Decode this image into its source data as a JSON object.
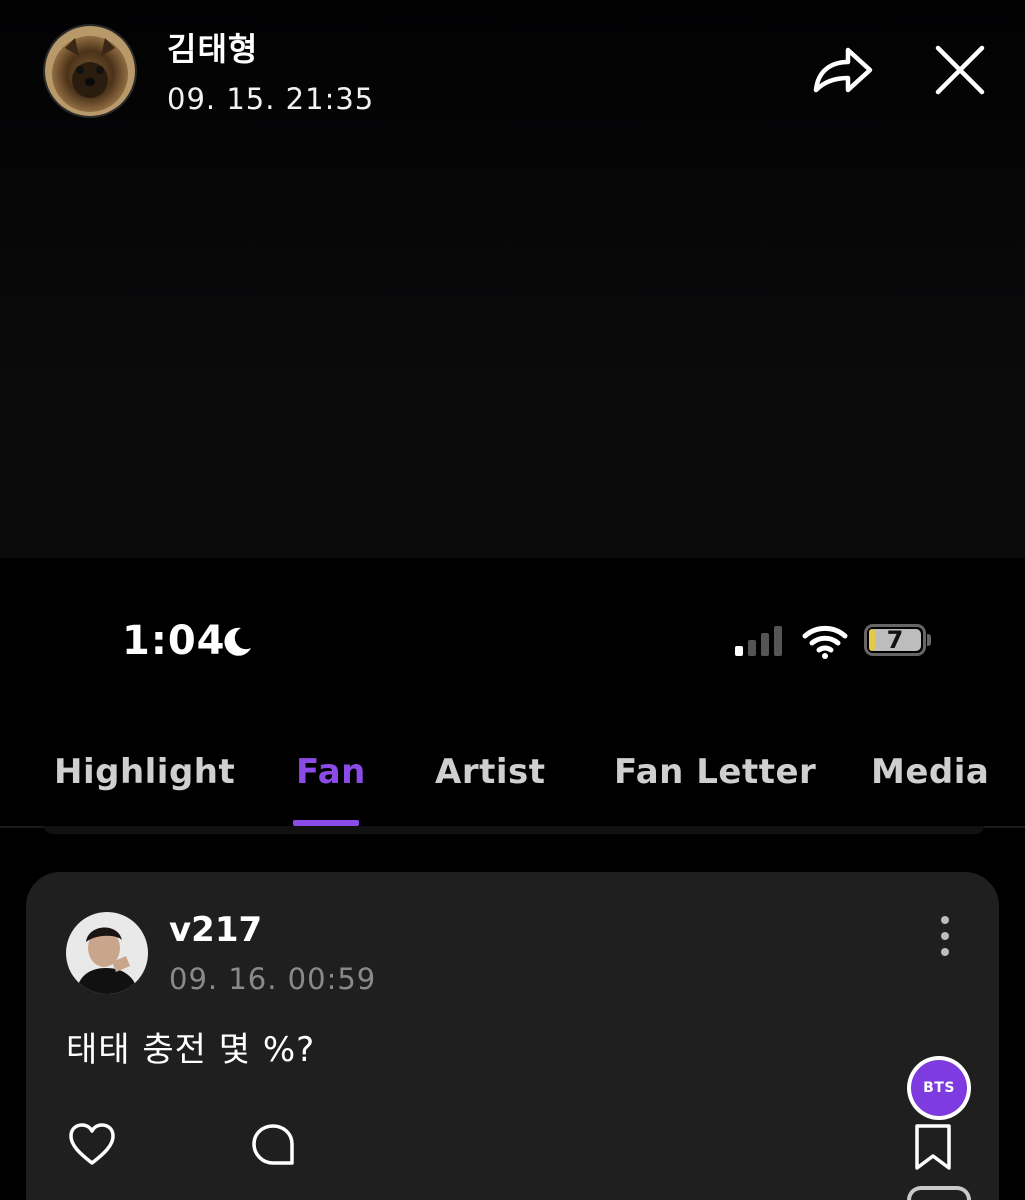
{
  "header": {
    "name": "김태형",
    "timestamp": "09. 15. 21:35"
  },
  "status_bar": {
    "time": "1:04",
    "battery": "7",
    "battery_color": "#e6c84a"
  },
  "tabs": [
    {
      "label": "Highlight",
      "active": false
    },
    {
      "label": "Fan",
      "active": true
    },
    {
      "label": "Artist",
      "active": false
    },
    {
      "label": "Fan Letter",
      "active": false
    },
    {
      "label": "Media",
      "active": false
    }
  ],
  "post": {
    "username": "v217",
    "timestamp": "09. 16. 00:59",
    "text": "태태 충전 몇 %?",
    "badge": "BTS"
  },
  "colors": {
    "accent": "#8b4be8",
    "badge": "#7d3be0",
    "card_bg": "#1f1f1f"
  },
  "icons": {
    "header": [
      "share-icon",
      "close-icon"
    ],
    "status": [
      "moon-icon",
      "signal-icon",
      "wifi-icon",
      "battery-icon"
    ],
    "post": [
      "more-icon",
      "like-icon",
      "comment-icon",
      "bookmark-icon"
    ]
  }
}
